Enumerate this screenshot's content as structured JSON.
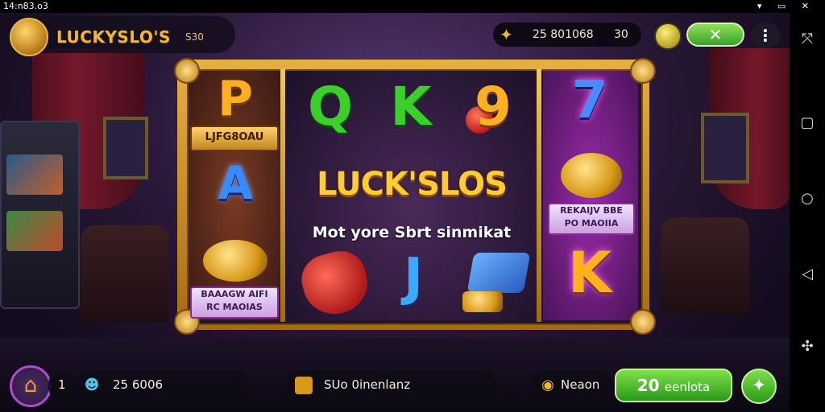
{
  "status_bar": {
    "time": "14:n83.o3",
    "icons": "▾ ▭ ✕"
  },
  "header": {
    "logo_text": "LUCKYSLO'S",
    "logo_sub": "S30",
    "coins_value": "25 801068",
    "coins_value2": "30",
    "close_symbol": "✕",
    "more_symbol": "⋮"
  },
  "reels": {
    "title": "LUCK'SLOS",
    "subtitle": "Mot yore Sbrt sinmikat",
    "left": {
      "top_symbol": "P",
      "badge_top": "LJFG8OAU",
      "mid_symbol": "A",
      "badge_bottom_l1": "BAAAGW AIFI",
      "badge_bottom_l2": "RC MAOIAS"
    },
    "middle": {
      "symbols_top": [
        "Q",
        "K",
        "9"
      ],
      "symbols_bottom": [
        "",
        "J",
        ""
      ]
    },
    "right": {
      "top_symbol": "7",
      "badge_l1": "REKAIJV BBE",
      "badge_l2": "PO MAOIIA",
      "bottom_symbol": "K"
    }
  },
  "bottom_bar": {
    "home_icon": "⌂",
    "level": "1",
    "balance": "25 6006",
    "reward_label": "SUo 0inenlanz",
    "bonus_label": "Neaon",
    "collect_number": "20",
    "collect_label": "eenlota",
    "spark_icon": "✦"
  },
  "navbar": {
    "icons": [
      "⤧",
      "▢",
      "○",
      "◁",
      "✣"
    ]
  },
  "colors": {
    "gold": "#f2b73a",
    "green": "#3aa22a",
    "purple": "#b04ad0"
  }
}
